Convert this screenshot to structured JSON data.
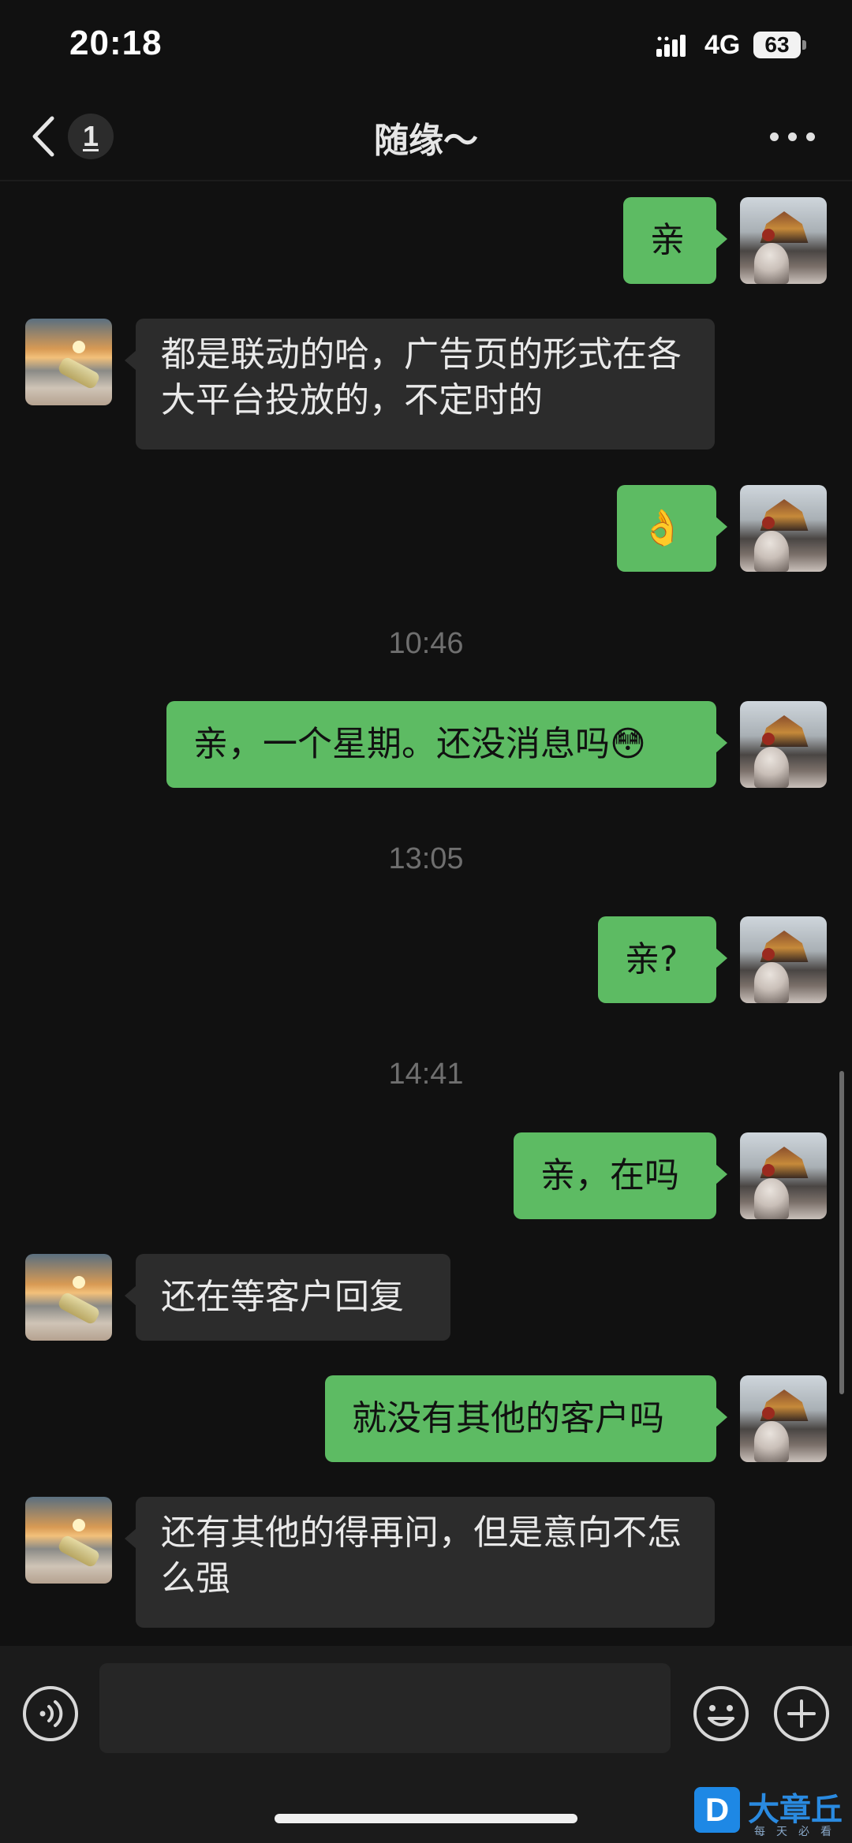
{
  "status_bar": {
    "time": "20:18",
    "network": "4G",
    "battery": "63",
    "battery_percent": 63
  },
  "nav": {
    "unread_count": "1",
    "title": "随缘～"
  },
  "messages": [
    {
      "side": "sent",
      "text": "亲"
    },
    {
      "side": "recv",
      "text": "都是联动的哈，广告页的形式在各大平台投放的，不定时的"
    },
    {
      "side": "sent",
      "text": "👌"
    },
    {
      "timestamp": "10:46"
    },
    {
      "side": "sent",
      "text": "亲，一个星期。还没消息吗😳"
    },
    {
      "timestamp": "13:05"
    },
    {
      "side": "sent",
      "text": "亲?"
    },
    {
      "timestamp": "14:41"
    },
    {
      "side": "sent",
      "text": "亲，在吗"
    },
    {
      "side": "recv",
      "text": "还在等客户回复"
    },
    {
      "side": "sent",
      "text": "就没有其他的客户吗"
    },
    {
      "side": "recv",
      "text": "还有其他的得再问，但是意向不怎么强"
    }
  ],
  "input": {
    "value": "",
    "placeholder": ""
  },
  "watermark": {
    "logo_letter": "D",
    "text": "大章丘",
    "sub": "每天必看"
  },
  "colors": {
    "background": "#111111",
    "sent_bubble": "#5dbb63",
    "recv_bubble": "#2c2c2c",
    "timestamp": "#6f6f6f"
  },
  "icons": [
    "signal-icon",
    "battery-icon",
    "back-chevron-icon",
    "more-icon",
    "avatar-icon",
    "voice-icon",
    "emoji-icon",
    "plus-icon"
  ]
}
